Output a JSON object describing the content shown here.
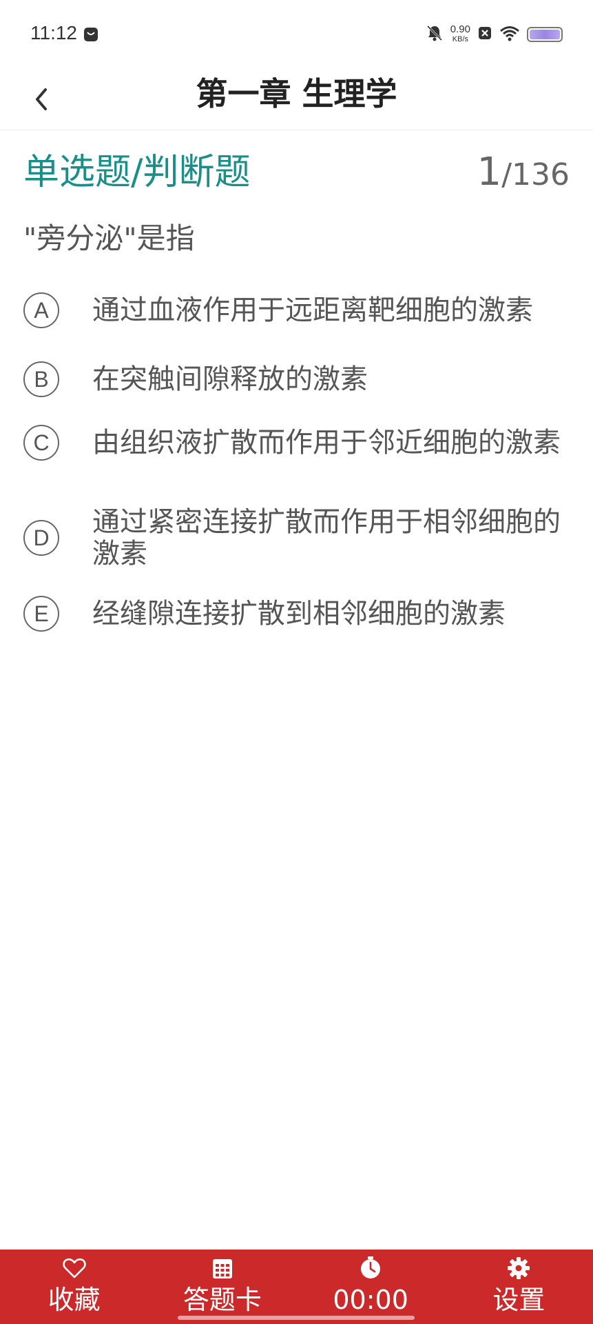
{
  "status_bar": {
    "time": "11:12",
    "net_speed_value": "0.90",
    "net_speed_unit": "KB/s",
    "battery_level": 1.0
  },
  "header": {
    "title": "第一章 生理学"
  },
  "question": {
    "type_label": "单选题/判断题",
    "current": "1",
    "separator": "/",
    "total": "136",
    "stem": "\"旁分泌\"是指",
    "options": [
      {
        "letter": "A",
        "text": "通过血液作用于远距离靶细胞的激素"
      },
      {
        "letter": "B",
        "text": "在突触间隙释放的激素"
      },
      {
        "letter": "C",
        "text": "由组织液扩散而作用于邻近细胞的激素"
      },
      {
        "letter": "D",
        "text": "通过紧密连接扩散而作用于相邻细胞的激素"
      },
      {
        "letter": "E",
        "text": "经缝隙连接扩散到相邻细胞的激素"
      }
    ]
  },
  "bottom_bar": {
    "favorite_label": "收藏",
    "answer_card_label": "答题卡",
    "timer": "00:00",
    "settings_label": "设置",
    "background_color": "#cc2a2a"
  },
  "colors": {
    "accent": "#1a8f8a",
    "bar": "#cc2a2a"
  }
}
